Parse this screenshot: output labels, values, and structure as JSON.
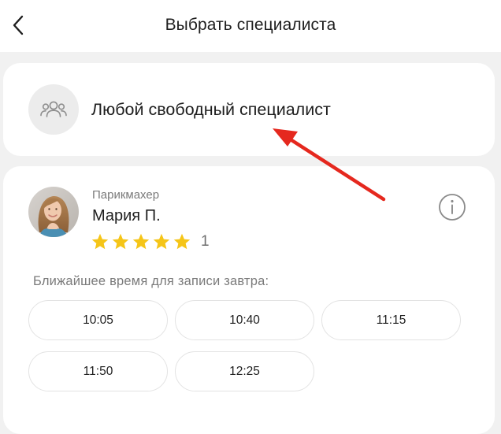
{
  "header": {
    "title": "Выбрать специалиста",
    "back_icon": "chevron-left-icon"
  },
  "any_specialist": {
    "label": "Любой свободный специалист",
    "icon": "group-icon"
  },
  "specialist": {
    "role": "Парикмахер",
    "name": "Мария П.",
    "rating_stars": 5,
    "rating_count": "1",
    "nearest_label": "Ближайшее время для записи завтра:",
    "slots": [
      "10:05",
      "10:40",
      "11:15",
      "11:50",
      "12:25"
    ]
  },
  "colors": {
    "star": "#f5c518",
    "arrow": "#e5281e",
    "background": "#f1f1f1",
    "card": "#ffffff"
  }
}
